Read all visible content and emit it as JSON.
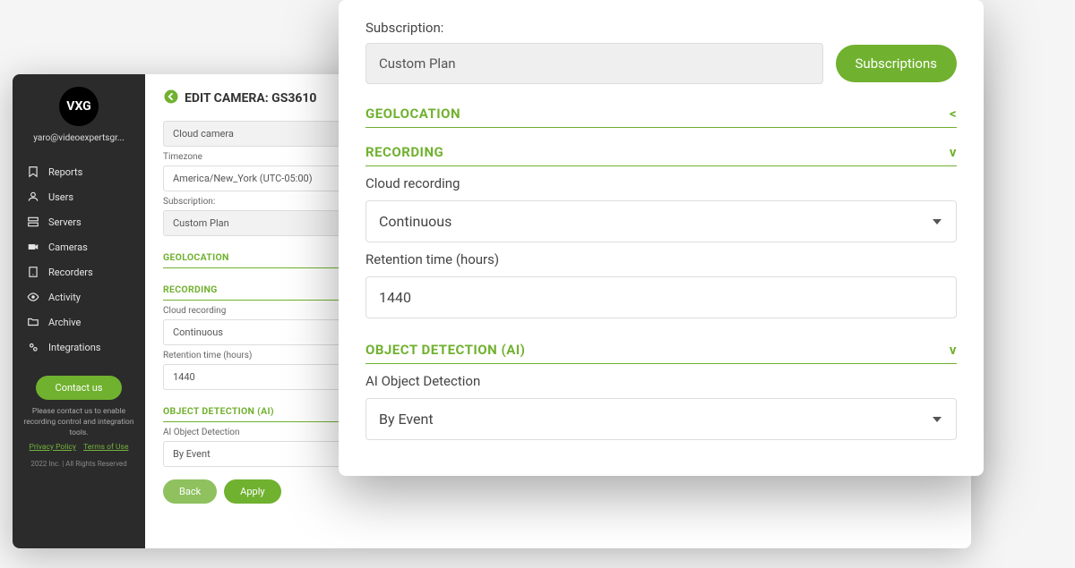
{
  "sidebar": {
    "logo": "VXG",
    "email": "yaro@videoexpertsgr...",
    "nav": [
      {
        "icon": "bookmark",
        "label": "Reports"
      },
      {
        "icon": "user",
        "label": "Users"
      },
      {
        "icon": "server",
        "label": "Servers"
      },
      {
        "icon": "camera",
        "label": "Cameras"
      },
      {
        "icon": "recorder",
        "label": "Recorders"
      },
      {
        "icon": "eye",
        "label": "Activity"
      },
      {
        "icon": "folder",
        "label": "Archive"
      },
      {
        "icon": "gears",
        "label": "Integrations"
      }
    ],
    "contact_label": "Contact us",
    "footer_text": "Please contact us to enable recording control and integration tools.",
    "privacy": "Privacy Policy",
    "terms": "Terms of Use",
    "copyright": "2022 Inc. | All Rights Reserved"
  },
  "main": {
    "title": "EDIT CAMERA: GS3610",
    "camera_type": "Cloud camera",
    "tz_label": "Timezone",
    "tz_value": "America/New_York (UTC-05:00)",
    "sub_label": "Subscription:",
    "sub_value": "Custom Plan",
    "sections": {
      "geo": "GEOLOCATION",
      "rec": "RECORDING",
      "obj": "OBJECT DETECTION (AI)"
    },
    "cloud_rec_label": "Cloud recording",
    "cloud_rec_value": "Continuous",
    "ret_label": "Retention time (hours)",
    "ret_value": "1440",
    "ai_label": "AI Object Detection",
    "ai_value": "By Event",
    "back": "Back",
    "apply": "Apply"
  },
  "modal": {
    "sub_label": "Subscription:",
    "sub_value": "Custom Plan",
    "subs_btn": "Subscriptions",
    "geo": "GEOLOCATION",
    "rec": "RECORDING",
    "obj": "OBJECT DETECTION (AI)",
    "cloud_rec_label": "Cloud recording",
    "cloud_rec_value": "Continuous",
    "ret_label": "Retention time (hours)",
    "ret_value": "1440",
    "ai_label": "AI Object Detection",
    "ai_value": "By Event",
    "chev_collapsed": "<",
    "chev_expanded": "v"
  }
}
